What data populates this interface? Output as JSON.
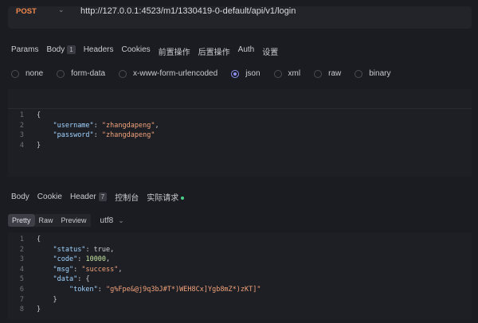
{
  "request": {
    "method": "POST",
    "url": "http://127.0.0.1:4523/m1/1330419-0-default/api/v1/login"
  },
  "request_tabs": [
    {
      "label": "Params"
    },
    {
      "label": "Body",
      "badge": "1"
    },
    {
      "label": "Headers"
    },
    {
      "label": "Cookies"
    },
    {
      "label": "前置操作"
    },
    {
      "label": "后置操作"
    },
    {
      "label": "Auth"
    },
    {
      "label": "设置"
    }
  ],
  "body_types": [
    {
      "label": "none",
      "selected": false
    },
    {
      "label": "form-data",
      "selected": false
    },
    {
      "label": "x-www-form-urlencoded",
      "selected": false
    },
    {
      "label": "json",
      "selected": true
    },
    {
      "label": "xml",
      "selected": false
    },
    {
      "label": "raw",
      "selected": false
    },
    {
      "label": "binary",
      "selected": false
    }
  ],
  "request_body": {
    "line_numbers": [
      "1",
      "2",
      "3",
      "4"
    ],
    "lines": [
      "{",
      "    \"username\": \"zhangdapeng\",",
      "    \"password\": \"zhangdapeng\"",
      "}"
    ]
  },
  "response_tabs": [
    {
      "label": "Body"
    },
    {
      "label": "Cookie"
    },
    {
      "label": "Header",
      "badge": "7"
    },
    {
      "label": "控制台"
    },
    {
      "label": "实际请求"
    }
  ],
  "view_modes": [
    "Pretty",
    "Raw",
    "Preview"
  ],
  "encoding": "utf8",
  "response_body": {
    "line_numbers": [
      "1",
      "2",
      "3",
      "4",
      "5",
      "6",
      "7",
      "8"
    ],
    "lines": [
      "{",
      "    \"status\": true,",
      "    \"code\": 10000,",
      "    \"msg\": \"success\",",
      "    \"data\": {",
      "        \"token\": \"g%Fpe&@j9q3bJ#T*)WEH8Cx]Ygb8mZ*)zKT]\"",
      "    }",
      "}"
    ]
  },
  "colors": {
    "method": "#f0884d",
    "key": "#9fd3ff",
    "string": "#f2a27a",
    "number": "#c6e6a0",
    "accent": "#8c8ff0",
    "status_dot": "#4ccf89"
  }
}
